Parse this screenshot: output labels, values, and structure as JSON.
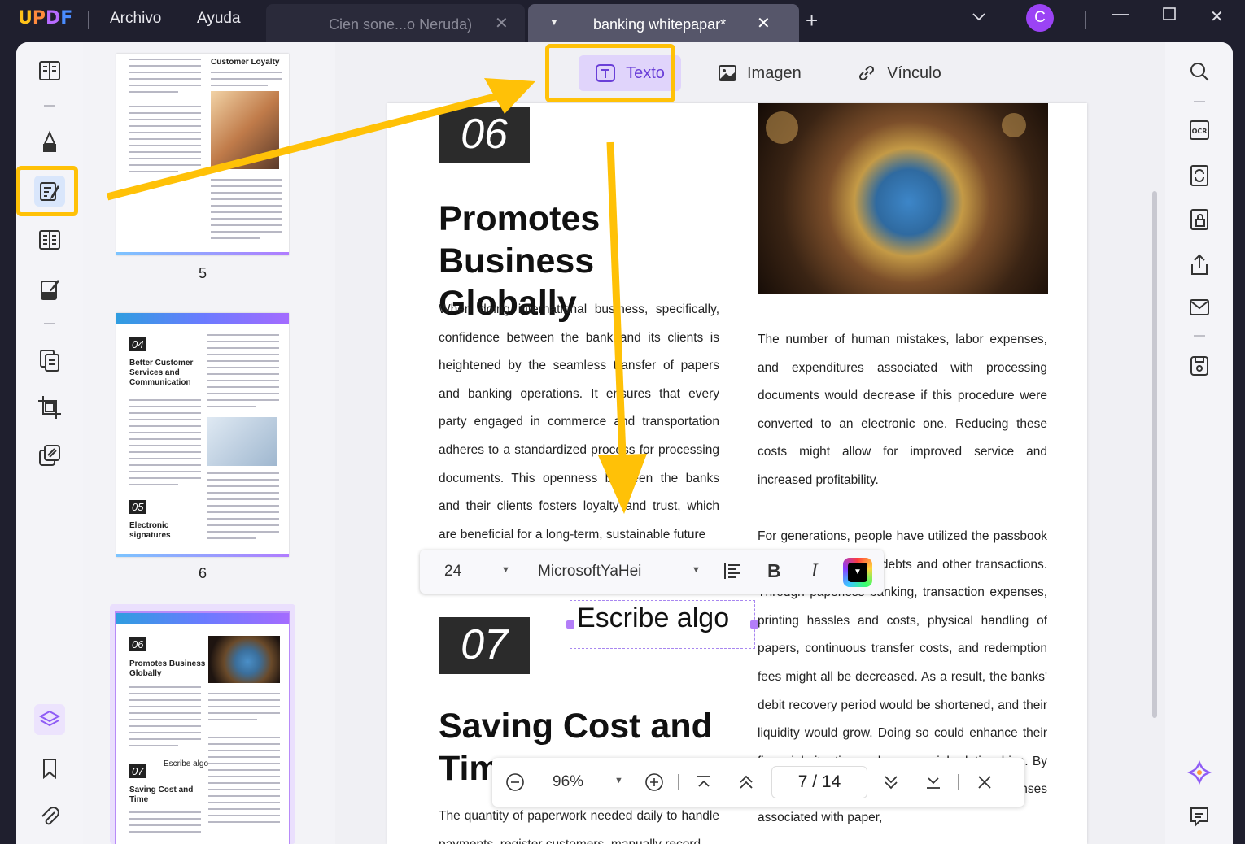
{
  "app": {
    "logo": "UPDF",
    "menus": [
      "Archivo",
      "Ayuda"
    ],
    "avatar_letter": "C",
    "accent": "#8f5cf5",
    "highlight": "#ffc107"
  },
  "tabs": [
    {
      "title": "Cien sone...o Neruda)",
      "active": false
    },
    {
      "title": "banking whitepapar*",
      "active": true
    }
  ],
  "edit_toolbar": {
    "texto": "Texto",
    "imagen": "Imagen",
    "vinculo": "Vínculo"
  },
  "thumbnails": [
    {
      "page": "5",
      "heading": "Customer Loyalty"
    },
    {
      "page": "6",
      "heading1": "Better Customer Services and Communication",
      "num1": "04",
      "num2": "05",
      "heading2": "Electronic signatures"
    },
    {
      "num1": "06",
      "heading1": "Promotes Business Globally",
      "num2": "07",
      "heading2": "Saving Cost and Time",
      "textbox": "Escribe algo"
    }
  ],
  "page": {
    "section1_num": "06",
    "section1_title": "Promotes Business Globally",
    "left_col1": "When doing international business, specifically, confidence between the bank and its clients is heightened by the seamless transfer of papers and banking operations. It ensures that every party engaged in commerce and transportation adheres to a standardized process for processing documents. This openness between the banks and their clients fosters loyalty and trust, which are beneficial for a long-term, sustainable future",
    "right_col1": "The number of human mistakes, labor expenses, and expenditures associated with processing documents would decrease if this procedure were converted to an electronic one. Reducing these costs might allow for improved service and increased profitability.",
    "right_col2": "For generations, people have utilized the passbook to keep track of their debts and other transactions. Through paperless banking, transaction expenses, printing hassles and costs, physical handling of papers, continuous transfer costs, and redemption fees might all be decreased. As a result, the banks' debit recovery period would be shortened, and their liquidity would grow. Doing so could enhance their financial situation and commercial relationships. By implementing this, the bank could reduce expenses associated with paper,",
    "section2_num": "07",
    "section2_title": "Saving Cost and Time",
    "left_col2": "The quantity of paperwork needed daily to handle payments, register customers, manually record"
  },
  "format_bar": {
    "font_size": "24",
    "font_family": "MicrosoftYaHei",
    "bold": "B",
    "italic": "I"
  },
  "textbox": {
    "text": "Escribe algo"
  },
  "zoom_bar": {
    "zoom": "96%",
    "current_page": "7",
    "separator": "/",
    "total_pages": "14"
  }
}
